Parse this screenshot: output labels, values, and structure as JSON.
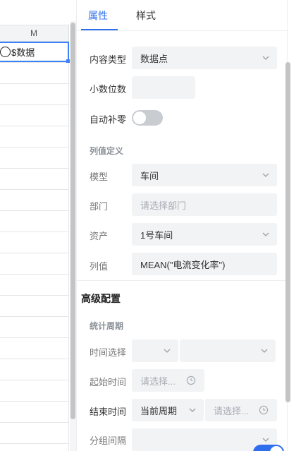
{
  "sheet": {
    "column_header": "M",
    "selected_cell_text": "$数据"
  },
  "tabs": [
    {
      "label": "属性",
      "active": true
    },
    {
      "label": "样式",
      "active": false
    }
  ],
  "properties": {
    "content_type": {
      "label": "内容类型",
      "value": "数据点"
    },
    "decimal_places": {
      "label": "小数位数",
      "value": ""
    },
    "auto_zero_pad": {
      "label": "自动补零",
      "enabled": false
    }
  },
  "column_definition": {
    "title": "列值定义",
    "model": {
      "label": "模型",
      "value": "车间"
    },
    "department": {
      "label": "部门",
      "placeholder": "请选择部门"
    },
    "asset": {
      "label": "资产",
      "value": "1号车间"
    },
    "column_value": {
      "label": "列值",
      "value": "MEAN(\"电流变化率\")"
    }
  },
  "advanced": {
    "title": "高级配置",
    "stat_period_title": "统计周期",
    "time_select": {
      "label": "时间选择",
      "value1": "",
      "value2": ""
    },
    "start_time": {
      "label": "起始时间",
      "placeholder": "请选择..."
    },
    "end_time": {
      "label": "结束时间",
      "mode": "当前周期",
      "placeholder": "请选择..."
    },
    "group_interval": {
      "label": "分组间隔",
      "value": ""
    }
  },
  "colors": {
    "accent": "#2f6fed",
    "field_bg": "#f2f3f5",
    "selection": "#3b82f6"
  }
}
